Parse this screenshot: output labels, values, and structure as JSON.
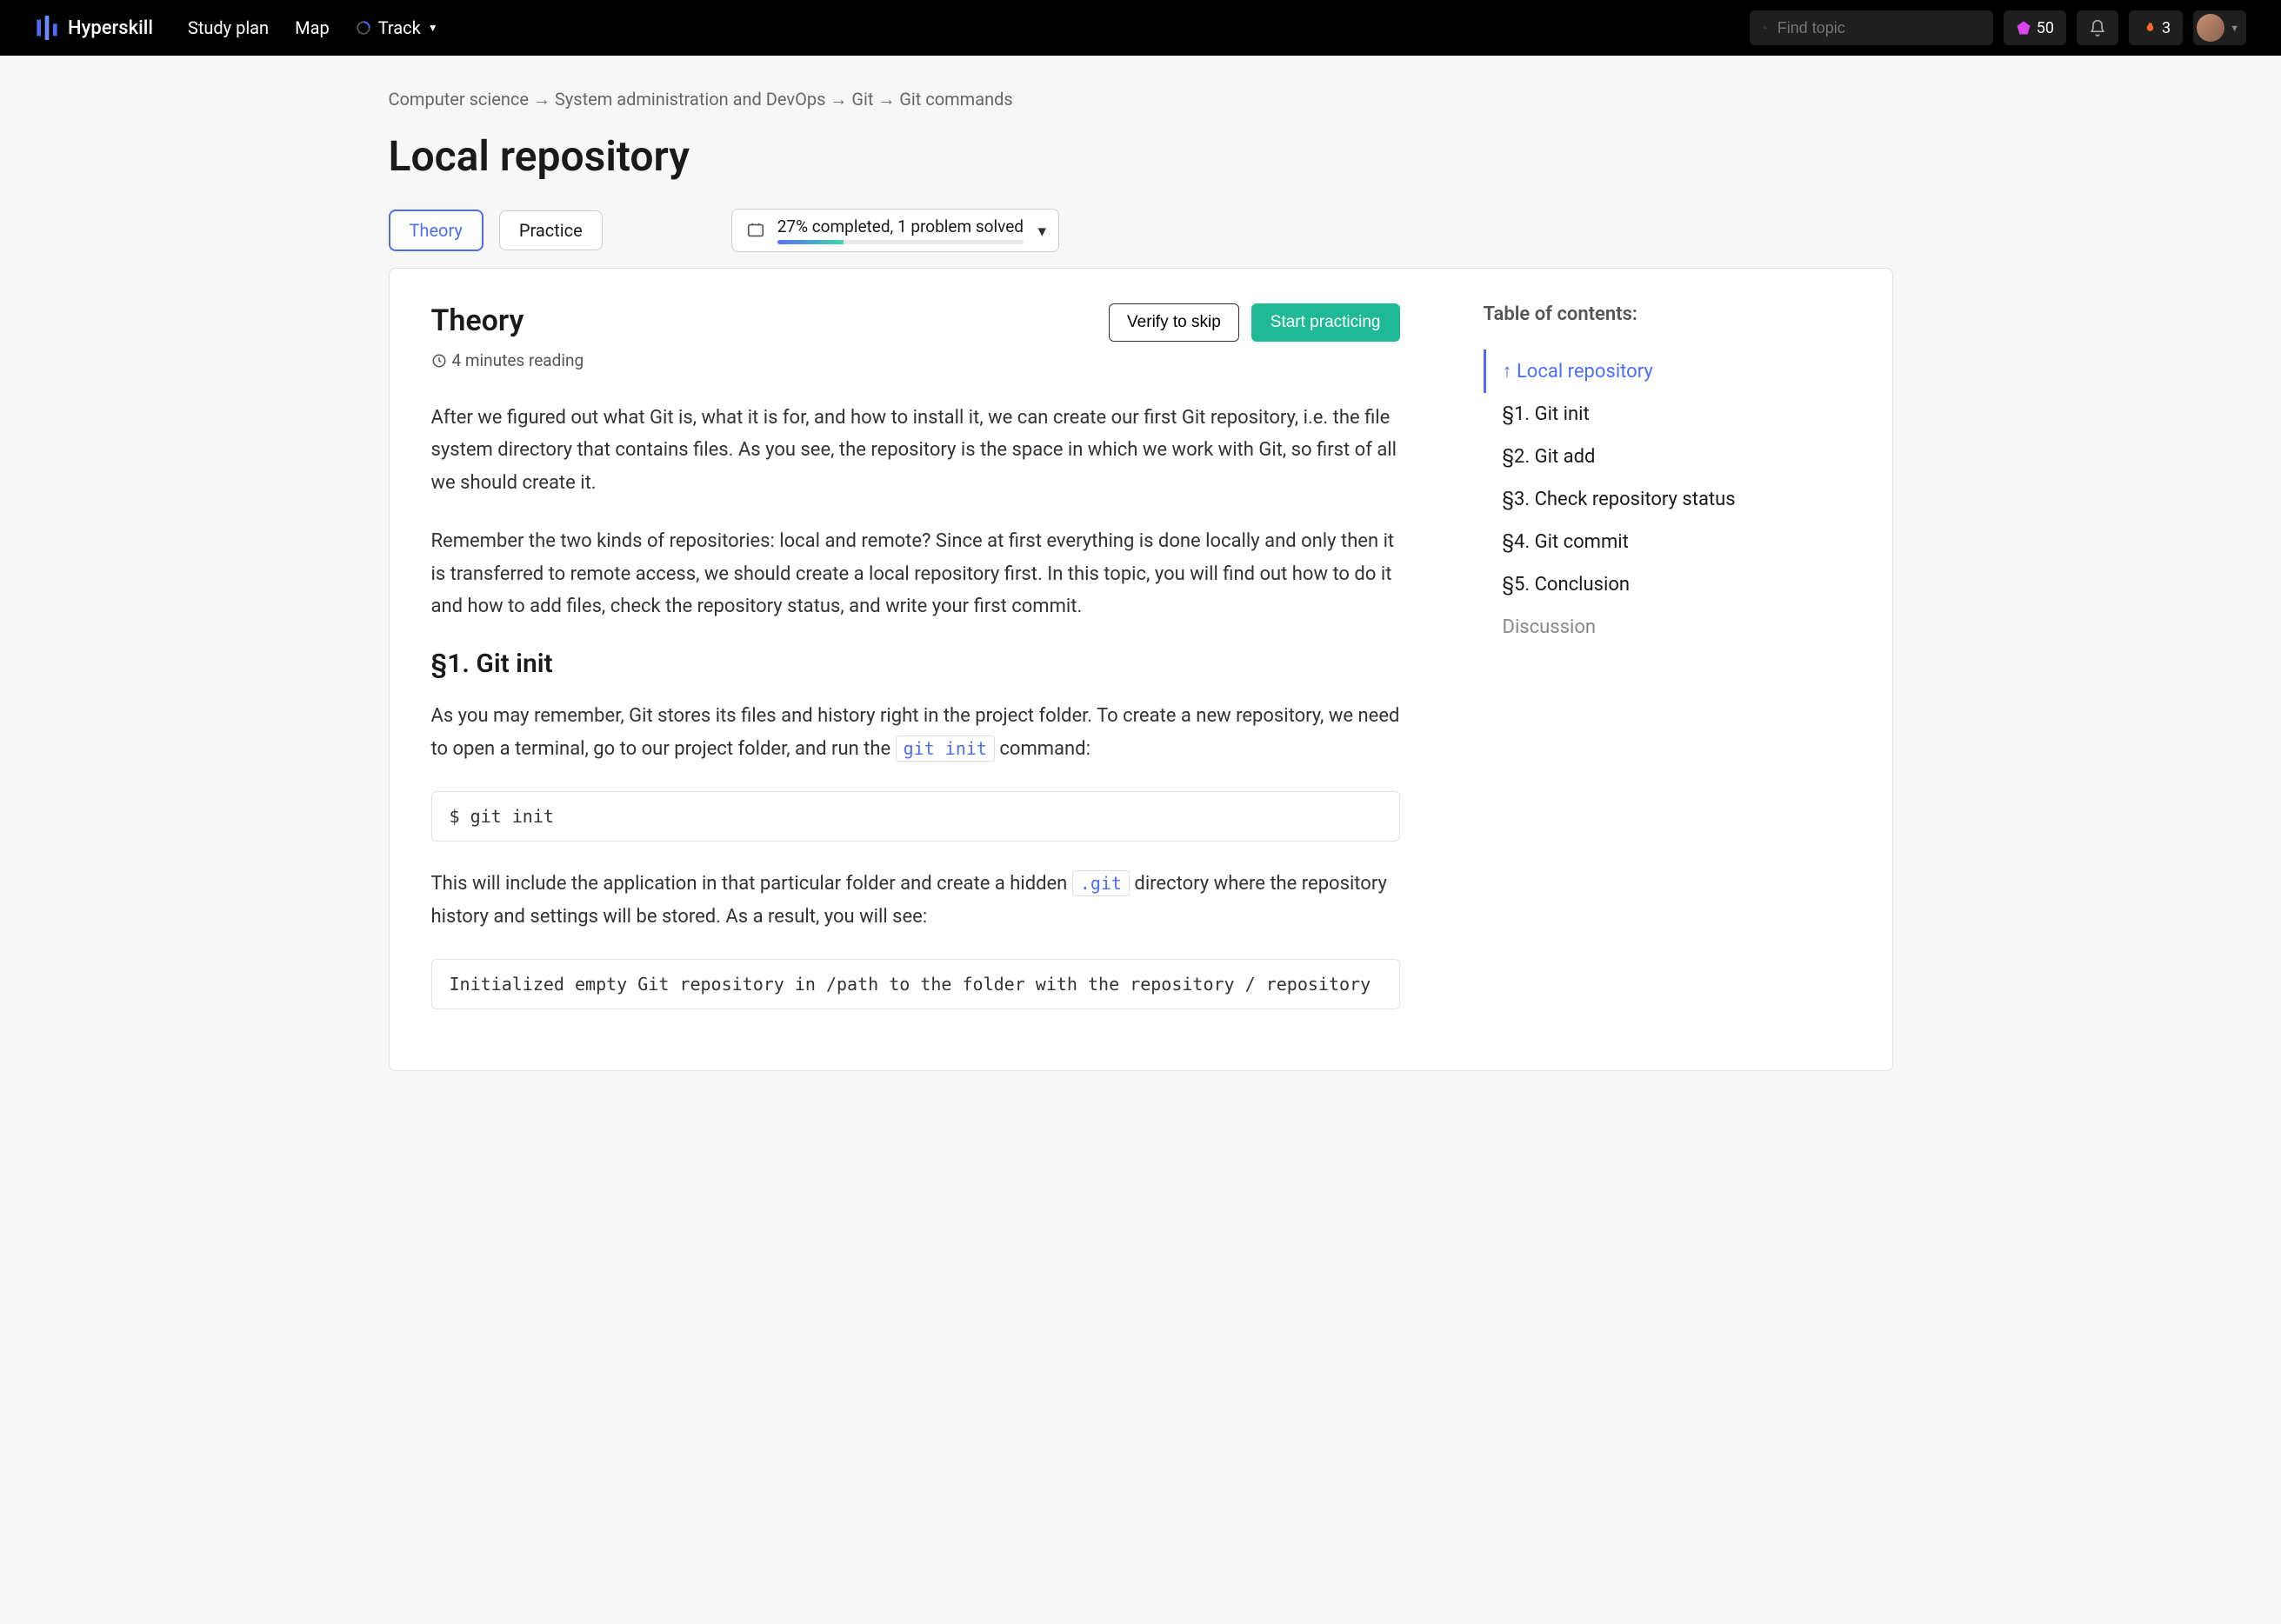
{
  "header": {
    "brand": "Hyperskill",
    "nav": {
      "study_plan": "Study plan",
      "map": "Map",
      "track": "Track"
    },
    "search_placeholder": "Find topic",
    "points": "50",
    "streak": "3"
  },
  "breadcrumb": {
    "l1": "Computer science",
    "l2": "System administration and DevOps",
    "l3": "Git",
    "l4": "Git commands",
    "sep": " → "
  },
  "page": {
    "title": "Local repository",
    "tabs": {
      "theory": "Theory",
      "practice": "Practice"
    },
    "progress_text": "27% completed, 1 problem solved"
  },
  "theory": {
    "heading": "Theory",
    "verify": "Verify to skip",
    "start": "Start practicing",
    "read_time": "4 minutes reading",
    "p1": "After we figured out what Git is, what it is for, and how to install it, we can create our first Git repository, i.e. the file system directory that contains files. As you see, the repository is the space in which we work with Git, so first of all we should create it.",
    "p2": "Remember the two kinds of repositories: local and remote? Since at first everything is done locally and only then it is transferred to remote access, we should create a local repository first. In this topic, you will find out how to do it and how to add files, check the repository status, and write your first commit.",
    "s1_h": "§1. Git init",
    "s1_p1a": "As you may remember, Git stores its files and history right in the project folder. To create a new repository, we need to open a terminal, go to our project folder, and run the ",
    "s1_code_inline1": "git init",
    "s1_p1b": " command:",
    "s1_block1": "$ git init",
    "s1_p2a": "This will include the application in that particular folder and create a hidden ",
    "s1_code_inline2": ".git",
    "s1_p2b": " directory where the repository history and settings will be stored. As a result, you will see:",
    "s1_block2": "Initialized empty Git repository in /path to the folder with the repository / repository"
  },
  "toc": {
    "title": "Table of contents:",
    "items": [
      "↑ Local repository",
      "§1. Git init",
      "§2. Git add",
      "§3. Check repository status",
      "§4. Git commit",
      "§5. Conclusion",
      "Discussion"
    ]
  }
}
